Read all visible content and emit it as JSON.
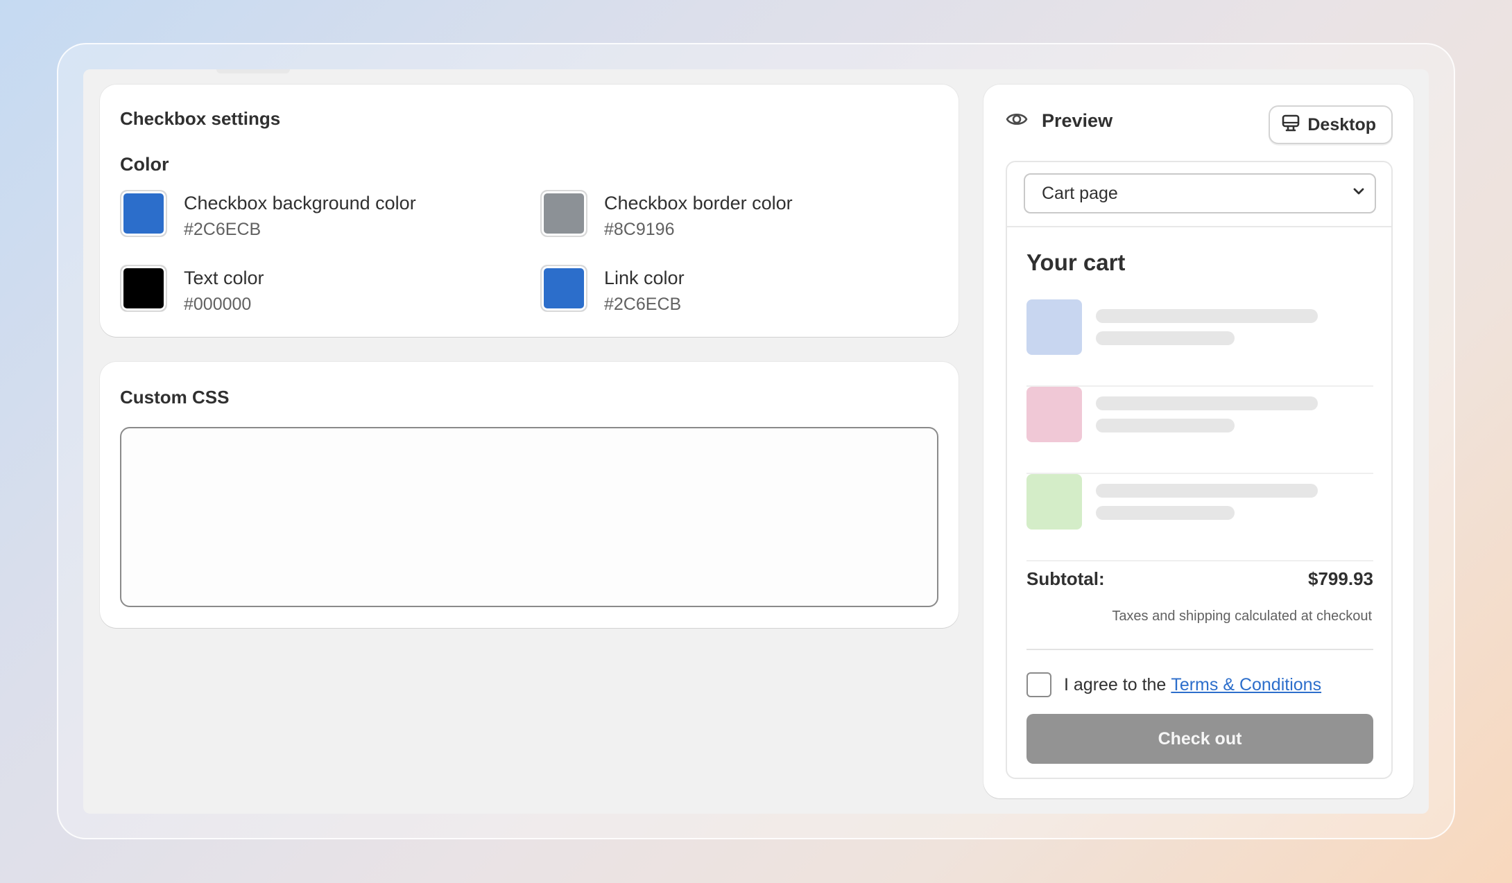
{
  "checkbox_settings": {
    "title": "Checkbox settings",
    "section_label": "Color",
    "colors": [
      {
        "name": "Checkbox background color",
        "hex": "#2C6ECB",
        "swatch": "#2C6ECB"
      },
      {
        "name": "Checkbox border color",
        "hex": "#8C9196",
        "swatch": "#8C9196"
      },
      {
        "name": "Text color",
        "hex": "#000000",
        "swatch": "#000000"
      },
      {
        "name": "Link color",
        "hex": "#2C6ECB",
        "swatch": "#2C6ECB"
      }
    ]
  },
  "custom_css": {
    "title": "Custom CSS",
    "value": ""
  },
  "preview": {
    "label": "Preview",
    "eye_icon": "eye-icon",
    "device_button": {
      "label": "Desktop",
      "icon": "desktop-icon"
    },
    "page_select": {
      "selected": "Cart page"
    },
    "cart": {
      "title": "Your cart",
      "item_thumb_colors": [
        "#C8D6F0",
        "#F0C8D6",
        "#D4EDC8"
      ],
      "subtotal_label": "Subtotal:",
      "subtotal_value": "$799.93",
      "tax_note": "Taxes and shipping calculated at checkout",
      "agree_text": "I agree to the",
      "agree_link": "Terms & Conditions",
      "checkout_label": "Check out"
    }
  },
  "colors": {
    "accent": "#2C6ECB",
    "checkout_button": "#939393"
  }
}
